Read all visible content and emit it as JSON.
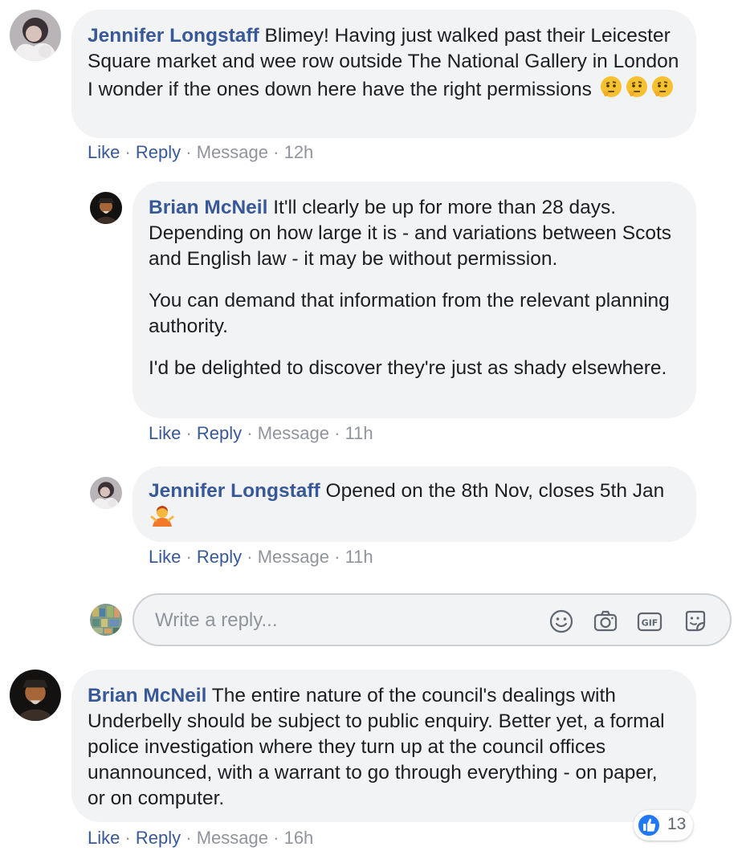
{
  "comments": [
    {
      "author": "Jennifer Longstaff",
      "text": "Blimey! Having just walked past their Leicester Square market and wee row outside The National Gallery in London I wonder if the ones down here have the right permissions",
      "emoji": [
        "thinking-face",
        "thinking-face",
        "thinking-face"
      ],
      "actions": {
        "like": "Like",
        "reply": "Reply",
        "message": "Message",
        "time": "12h"
      },
      "replies": [
        {
          "author": "Brian McNeil",
          "paragraphs": [
            "It'll clearly be up for more than 28 days. Depending on how large it is - and variations between Scots and English law - it may be without permission.",
            "You can demand that information from the relevant planning authority.",
            "I'd be delighted to discover they're just as shady elsewhere."
          ],
          "actions": {
            "like": "Like",
            "reply": "Reply",
            "message": "Message",
            "time": "11h"
          }
        },
        {
          "author": "Jennifer Longstaff",
          "text": "Opened on the 8th Nov, closes 5th Jan",
          "emoji": [
            "woman-shrugging"
          ],
          "actions": {
            "like": "Like",
            "reply": "Reply",
            "message": "Message",
            "time": "11h"
          }
        }
      ]
    },
    {
      "author": "Brian McNeil",
      "text": "The entire nature of the council's dealings with Underbelly should be subject to public enquiry. Better yet, a formal police investigation where they turn up at the council offices unannounced, with a warrant to go through everything - on paper, or on computer.",
      "actions": {
        "like": "Like",
        "reply": "Reply",
        "message": "Message",
        "time": "16h"
      },
      "reactions": {
        "icon": "like-icon",
        "count": "13",
        "color": "#2078f4"
      }
    }
  ],
  "reply_box": {
    "placeholder": "Write a reply...",
    "icons": [
      "emoji-icon",
      "camera-icon",
      "gif-icon",
      "sticker-icon"
    ]
  },
  "colors": {
    "author": "#385898",
    "bubble": "#f2f3f5",
    "meta": "#90949c"
  }
}
